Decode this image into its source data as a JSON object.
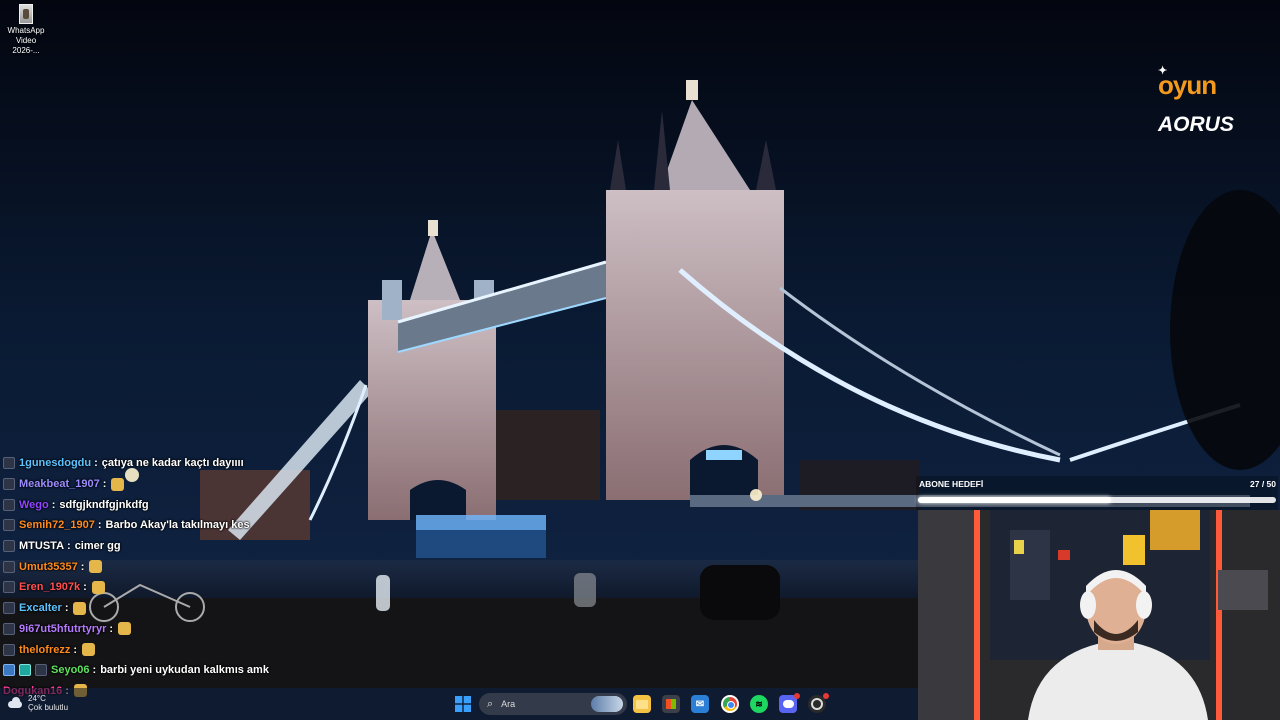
{
  "desktop": {
    "icons": [
      {
        "label": "WhatsApp Video 2026-..."
      }
    ]
  },
  "overlay": {
    "logos": {
      "oyun": "oyun",
      "aorus": "AORUS"
    },
    "subscriber_goal": {
      "label": "ABONE HEDEFİ",
      "count_text": "27 / 50",
      "current": 27,
      "target": 50
    }
  },
  "chat": {
    "messages": [
      {
        "user": "1gunesdogdu",
        "color": "#5ec2ff",
        "text": "çatıya ne kadar kaçtı dayıııı",
        "badges": [
          "default"
        ]
      },
      {
        "user": "Meakbeat_1907",
        "color": "#9b8cff",
        "text": "",
        "badges": [
          "default"
        ],
        "emote": true
      },
      {
        "user": "Wego",
        "color": "#9146ff",
        "text": "sdfgjkndfgjnkdfg",
        "badges": [
          "default"
        ]
      },
      {
        "user": "Semih72_1907",
        "color": "#ff8a1e",
        "text": "Barbo Akay'la takılmayı kes",
        "badges": [
          "default"
        ]
      },
      {
        "user": "MTUSTA",
        "color": "#ffffff",
        "text": "cimer gg",
        "badges": [
          "default"
        ]
      },
      {
        "user": "Umut35357",
        "color": "#ff8a1e",
        "text": "",
        "badges": [
          "default"
        ],
        "emote": true
      },
      {
        "user": "Eren_1907k",
        "color": "#ff4f4f",
        "text": "",
        "badges": [
          "default"
        ],
        "emote": true
      },
      {
        "user": "Excalter",
        "color": "#5ec2ff",
        "text": "",
        "badges": [
          "default"
        ],
        "emote": true
      },
      {
        "user": "9i67ut5hfutrtyryr",
        "color": "#b57bff",
        "text": "",
        "badges": [
          "default"
        ],
        "emote": true
      },
      {
        "user": "thelofrezz",
        "color": "#ff8a1e",
        "text": "",
        "badges": [
          "default"
        ],
        "emote": true
      },
      {
        "user": "Seyo06",
        "color": "#5fe05f",
        "text": "barbi yeni uykudan kalkmıs amk",
        "badges": [
          "alt",
          "mod",
          "default"
        ]
      },
      {
        "user": "Dogukan16",
        "color": "#ff3fa0",
        "text": "",
        "badges": [],
        "emote": true
      }
    ]
  },
  "taskbar": {
    "weather": {
      "temp": "24°C",
      "desc": "Çok bulutlu"
    },
    "search": {
      "placeholder": "Ara"
    },
    "apps": [
      {
        "name": "start",
        "icon": "windows-icon",
        "color": "#3aa0ff"
      },
      {
        "name": "file-explorer",
        "icon": "folder-icon",
        "color": "#f5c343"
      },
      {
        "name": "store",
        "icon": "store-icon",
        "color": "#3b3f4a"
      },
      {
        "name": "mail",
        "icon": "mail-icon",
        "color": "#2b7fd6"
      },
      {
        "name": "chrome",
        "icon": "chrome-icon",
        "color": "#34a853"
      },
      {
        "name": "spotify",
        "icon": "spotify-icon",
        "color": "#1ed760"
      },
      {
        "name": "discord",
        "icon": "discord-icon",
        "color": "#5865f2"
      },
      {
        "name": "obs",
        "icon": "obs-icon",
        "color": "#2a2a2a"
      }
    ]
  }
}
